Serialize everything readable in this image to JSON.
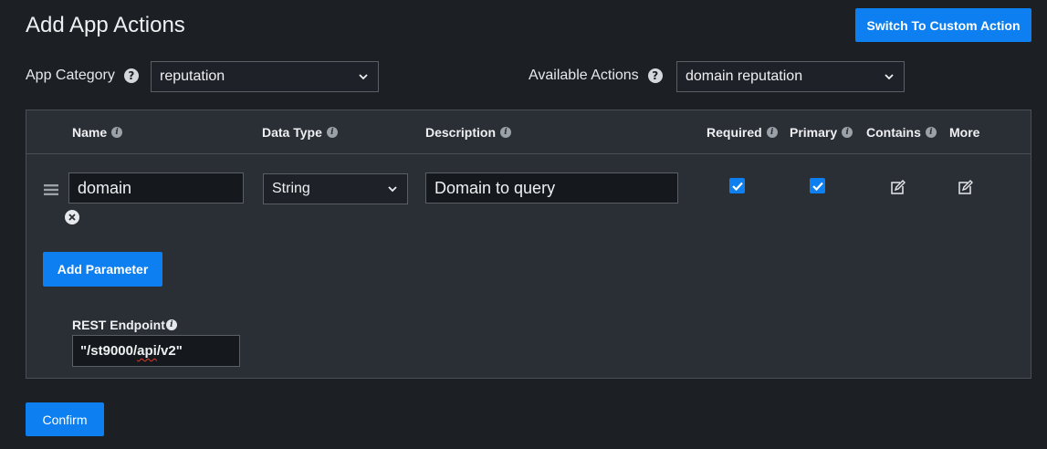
{
  "header": {
    "title": "Add App Actions",
    "switch_button": "Switch To Custom Action"
  },
  "app_category": {
    "label": "App Category",
    "value": "reputation"
  },
  "available_actions": {
    "label": "Available Actions",
    "value": "domain reputation"
  },
  "table": {
    "columns": {
      "name": "Name",
      "data_type": "Data Type",
      "description": "Description",
      "required": "Required",
      "primary": "Primary",
      "contains": "Contains",
      "more": "More"
    },
    "rows": [
      {
        "name": "domain",
        "data_type": "String",
        "description": "Domain to query",
        "required": true,
        "primary": true
      }
    ]
  },
  "add_parameter_button": "Add Parameter",
  "rest_endpoint": {
    "label": "REST Endpoint",
    "value_prefix": "\"/st9000/",
    "value_misspelled": "api",
    "value_suffix": "/v2\""
  },
  "confirm_button": "Confirm",
  "colors": {
    "accent": "#0d7ff0",
    "background": "#1c1f24",
    "panel": "#2a2e35"
  },
  "icons": {
    "help": "question-circle-icon",
    "info": "info-circle-icon",
    "dropdown": "chevron-down-icon",
    "drag": "drag-handle-icon",
    "remove": "remove-circle-icon",
    "edit": "edit-icon",
    "check": "check-icon"
  }
}
